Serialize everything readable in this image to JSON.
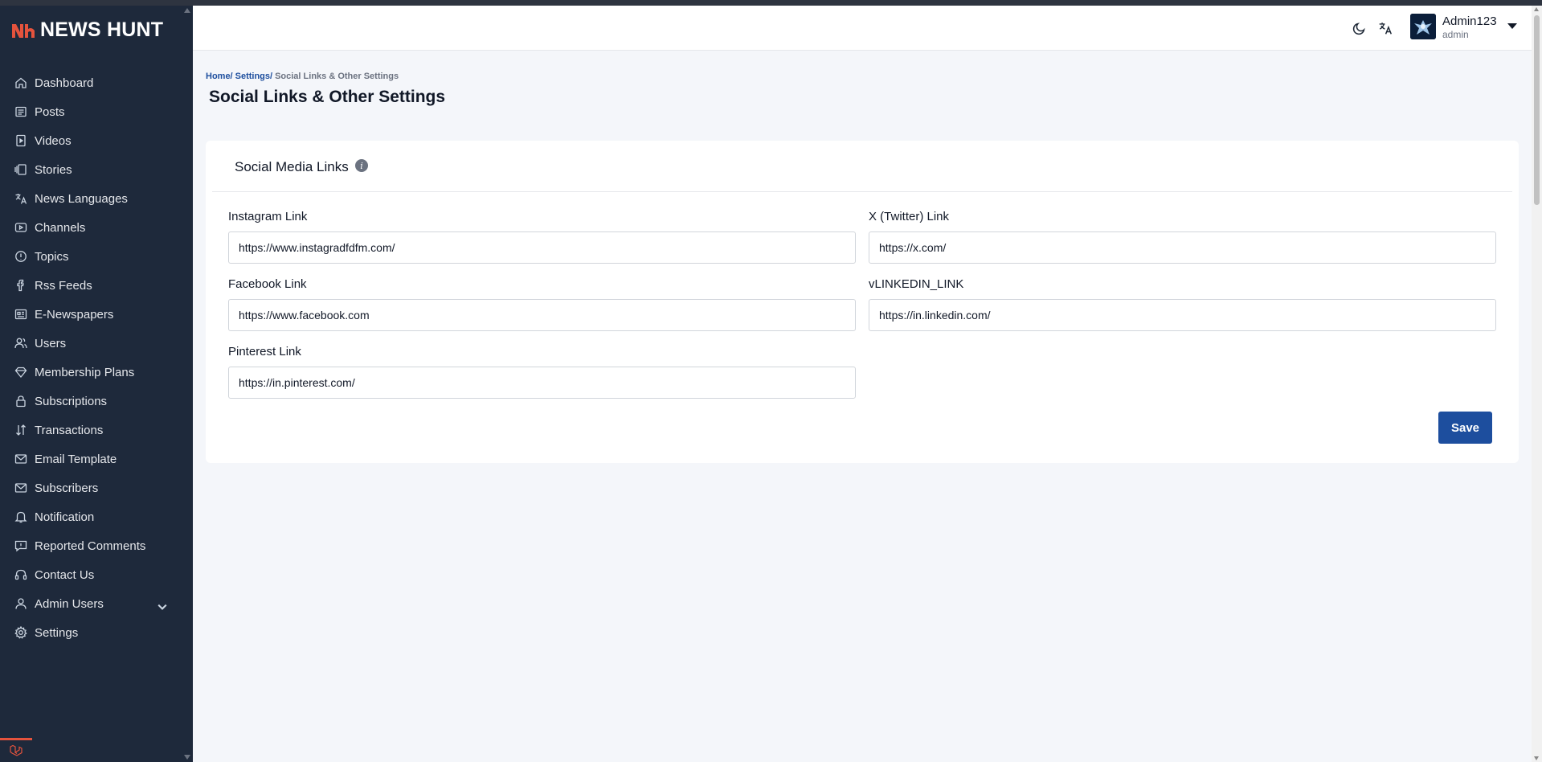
{
  "brand": {
    "name": "NEWS HUNT",
    "logo_mark": "Nh",
    "accent": "#e5533d"
  },
  "sidebar": {
    "items": [
      {
        "label": "Dashboard",
        "icon": "home-icon"
      },
      {
        "label": "Posts",
        "icon": "posts-icon"
      },
      {
        "label": "Videos",
        "icon": "video-icon"
      },
      {
        "label": "Stories",
        "icon": "stories-icon"
      },
      {
        "label": "News Languages",
        "icon": "translate-icon"
      },
      {
        "label": "Channels",
        "icon": "channels-icon"
      },
      {
        "label": "Topics",
        "icon": "topics-icon"
      },
      {
        "label": "Rss Feeds",
        "icon": "rss-icon"
      },
      {
        "label": "E-Newspapers",
        "icon": "newspaper-icon"
      },
      {
        "label": "Users",
        "icon": "users-icon"
      },
      {
        "label": "Membership Plans",
        "icon": "diamond-icon"
      },
      {
        "label": "Subscriptions",
        "icon": "lock-icon"
      },
      {
        "label": "Transactions",
        "icon": "transactions-icon"
      },
      {
        "label": "Email Template",
        "icon": "mail-icon"
      },
      {
        "label": "Subscribers",
        "icon": "mail-icon"
      },
      {
        "label": "Notification",
        "icon": "bell-icon"
      },
      {
        "label": "Reported Comments",
        "icon": "comment-alert-icon"
      },
      {
        "label": "Contact Us",
        "icon": "headset-icon"
      },
      {
        "label": "Admin Users",
        "icon": "admin-user-icon",
        "has_submenu": true
      },
      {
        "label": "Settings",
        "icon": "gear-icon"
      }
    ]
  },
  "topbar": {
    "user_name": "Admin123",
    "user_role": "admin",
    "icons": [
      "moon-icon",
      "translate-icon"
    ]
  },
  "breadcrumb": {
    "home": "Home/",
    "settings": "Settings/",
    "current": "Social Links & Other Settings"
  },
  "page_title": "Social Links & Other Settings",
  "card": {
    "title": "Social Media Links",
    "info_glyph": "i",
    "fields": {
      "instagram": {
        "label": "Instagram Link",
        "value": "https://www.instagradfdfm.com/"
      },
      "twitter": {
        "label": "X (Twitter) Link",
        "value": "https://x.com/"
      },
      "facebook": {
        "label": "Facebook Link",
        "value": "https://www.facebook.com"
      },
      "linkedin": {
        "label": "vLINKEDIN_LINK",
        "value": "https://in.linkedin.com/"
      },
      "pinterest": {
        "label": "Pinterest Link",
        "value": "https://in.pinterest.com/"
      }
    },
    "save_label": "Save"
  },
  "colors": {
    "sidebar_bg": "#1e293b",
    "primary": "#1d4e9e",
    "page_bg": "#f4f6fa"
  }
}
